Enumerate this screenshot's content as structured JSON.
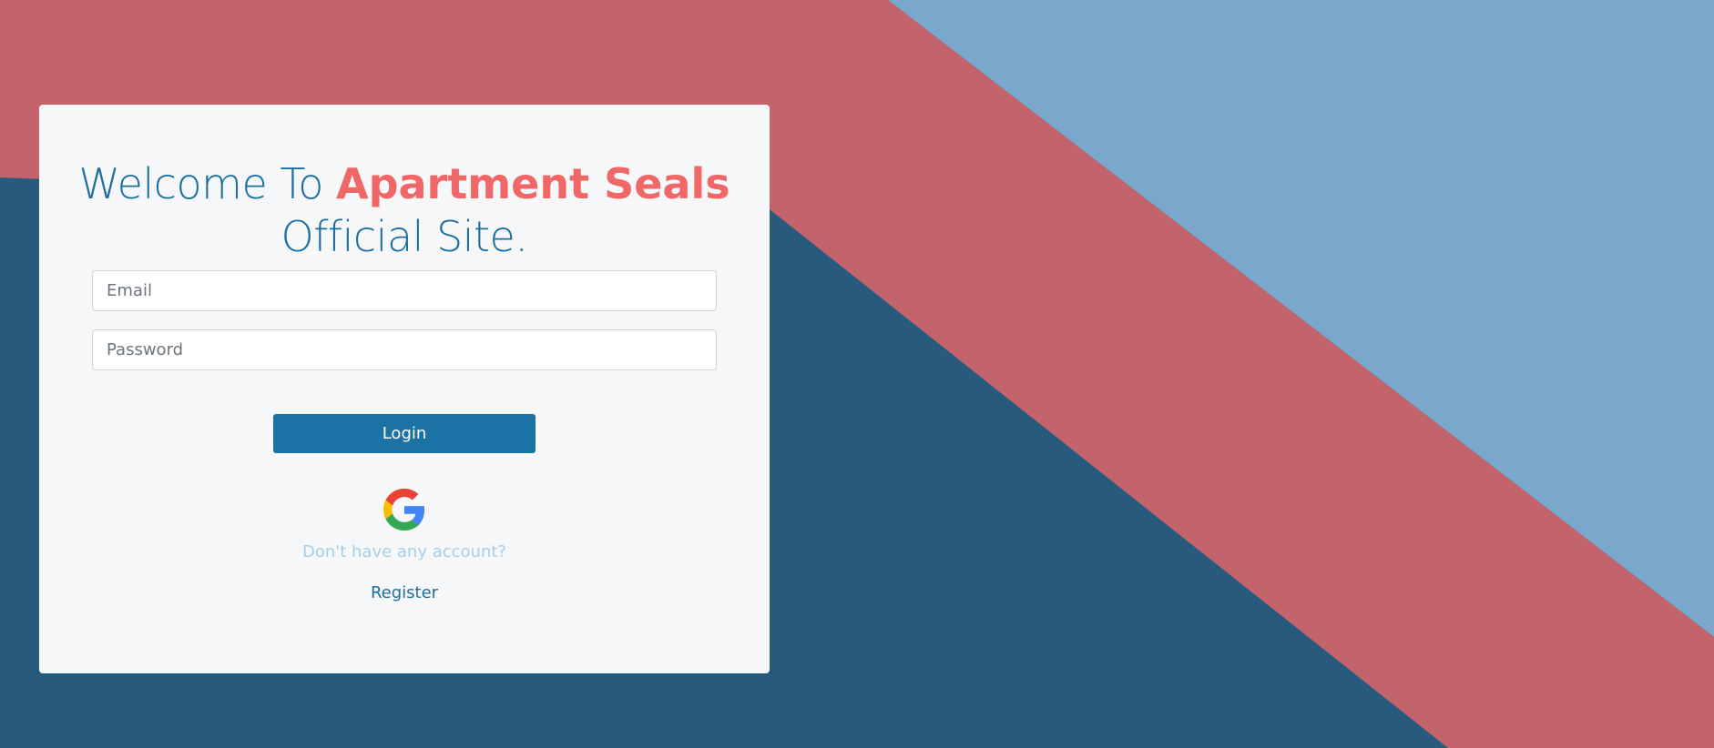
{
  "colors": {
    "card_background": "#f6f7f9",
    "heading_blue": "#1d6e9e",
    "brand_red": "#f06767",
    "button_blue": "#1b73a5",
    "muted_link": "#a5cfe6",
    "bg_dark_blue": "#285a7d",
    "bg_red": "#c3646d",
    "bg_light_blue": "#79a8cc"
  },
  "heading": {
    "prefix": "Welcome To ",
    "brand": "Apartment Seals",
    "suffix": "Official Site."
  },
  "form": {
    "email_placeholder": "Email",
    "password_placeholder": "Password",
    "login_label": "Login"
  },
  "social": {
    "google_icon": "google-icon"
  },
  "footer": {
    "prompt": "Don't have any account?",
    "register_label": "Register"
  }
}
